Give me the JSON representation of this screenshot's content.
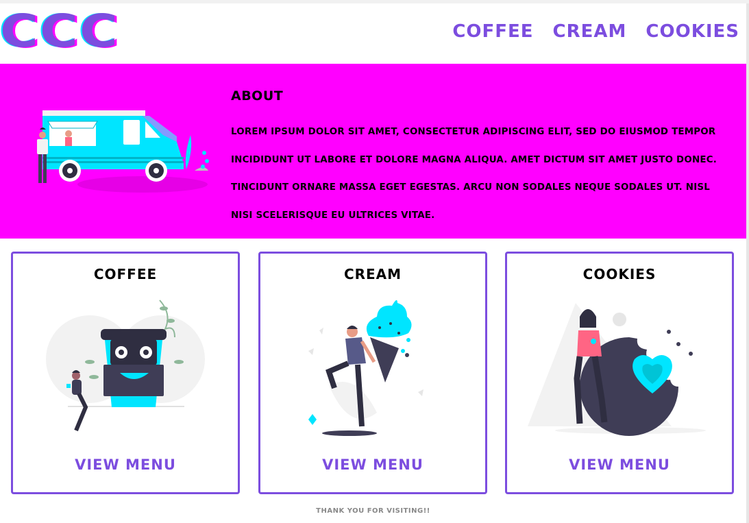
{
  "header": {
    "logo": "CCC",
    "nav": [
      "COFFEE",
      "CREAM",
      "COOKIES"
    ]
  },
  "about": {
    "title": "ABOUT",
    "text": "LOREM IPSUM DOLOR SIT AMET, CONSECTETUR ADIPISCING ELIT, SED DO EIUSMOD TEMPOR INCIDIDUNT UT LABORE ET DOLORE MAGNA ALIQUA. AMET DICTUM SIT AMET JUSTO DONEC. TINCIDUNT ORNARE MASSA EGET EGESTAS. ARCU NON SODALES NEQUE SODALES UT. NISL NISI SCELERISQUE EU ULTRICES VITAE."
  },
  "cards": [
    {
      "title": "COFFEE",
      "link": "VIEW MENU",
      "illustration": "coffee-cup-illustration"
    },
    {
      "title": "CREAM",
      "link": "VIEW MENU",
      "illustration": "ice-cream-illustration"
    },
    {
      "title": "COOKIES",
      "link": "VIEW MENU",
      "illustration": "cookie-illustration"
    }
  ],
  "footer": "THANK YOU FOR VISITING!!",
  "colors": {
    "accent": "#7c4ddf",
    "hero": "#ff00ff",
    "cyan": "#00e5ff",
    "dark": "#3f3d56"
  }
}
